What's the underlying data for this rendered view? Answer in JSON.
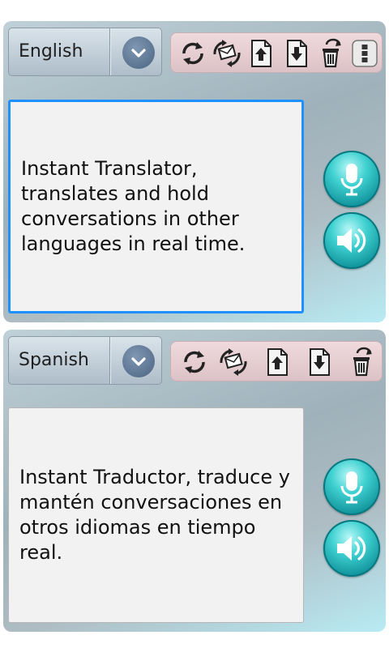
{
  "source_panel": {
    "language": "English",
    "text": "Instant Translator, translates and hold conversations in other languages in real time."
  },
  "target_panel": {
    "language": "Spanish",
    "text": "Instant Traductor, traduce y mantén conversaciones en otros idiomas en tiempo real."
  },
  "icons": {
    "language_dropdown": "chevron-down-icon",
    "swap": "refresh-icon",
    "share": "envelope-swap-icon",
    "upload": "upload-icon",
    "download": "download-icon",
    "delete": "trash-icon",
    "menu": "more-vertical-icon",
    "microphone": "microphone-icon",
    "speaker": "speaker-icon"
  },
  "colors": {
    "active_border": "#1e90ff",
    "action_button": "#1fb5bc",
    "toolbar_bg": "#e8d0d4"
  }
}
